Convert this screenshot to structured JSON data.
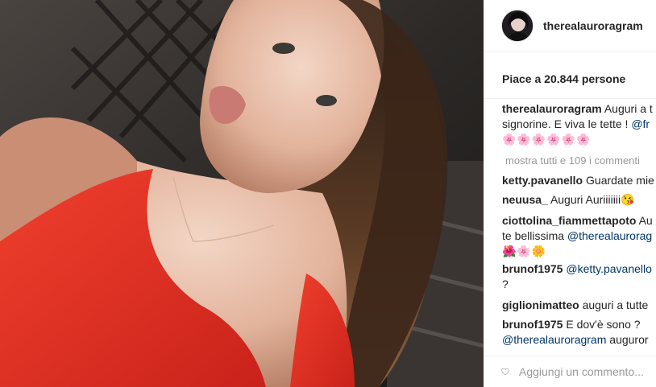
{
  "post": {
    "username": "therealauroragram",
    "likes_text": "Piace a 20.844 persone",
    "show_all_text": "mostra tutti e 109 i commenti",
    "add_comment_placeholder": "Aggiungi un commento..."
  },
  "comments": [
    {
      "user": "therealauroragram",
      "text": "Auguri a t",
      "line2": "signorine. E viva le tette ! ",
      "mention": "@fr",
      "line3": "🌸🌸🌸🌸🌸🌸"
    },
    {
      "user": "ketty.pavanello",
      "text": "Guardate mie"
    },
    {
      "user": "neuusa_",
      "text": "Auguri Auriiiiiii😘"
    },
    {
      "user": "ciottolina_fiammettapoto",
      "text": "Au",
      "line2": "te bellissima ",
      "mention": "@therealaurorag",
      "line3": "🌺🌸🌼"
    },
    {
      "user": "brunof1975",
      "text": "",
      "mention": "@ketty.pavanello",
      "line2": "?"
    },
    {
      "user": "giglionimatteo",
      "text": "auguri a tutte"
    },
    {
      "user": "brunof1975",
      "text": "E dov'è sono ?",
      "line2mention": "@therealauroragram",
      "line2": " auguror"
    }
  ],
  "icons": {
    "like": "heart-outline-icon",
    "avatar": "profile-photo"
  },
  "colors": {
    "accent_red": "#e8352a",
    "text_dark": "#262626",
    "text_muted": "#999999",
    "mention": "#003569"
  }
}
